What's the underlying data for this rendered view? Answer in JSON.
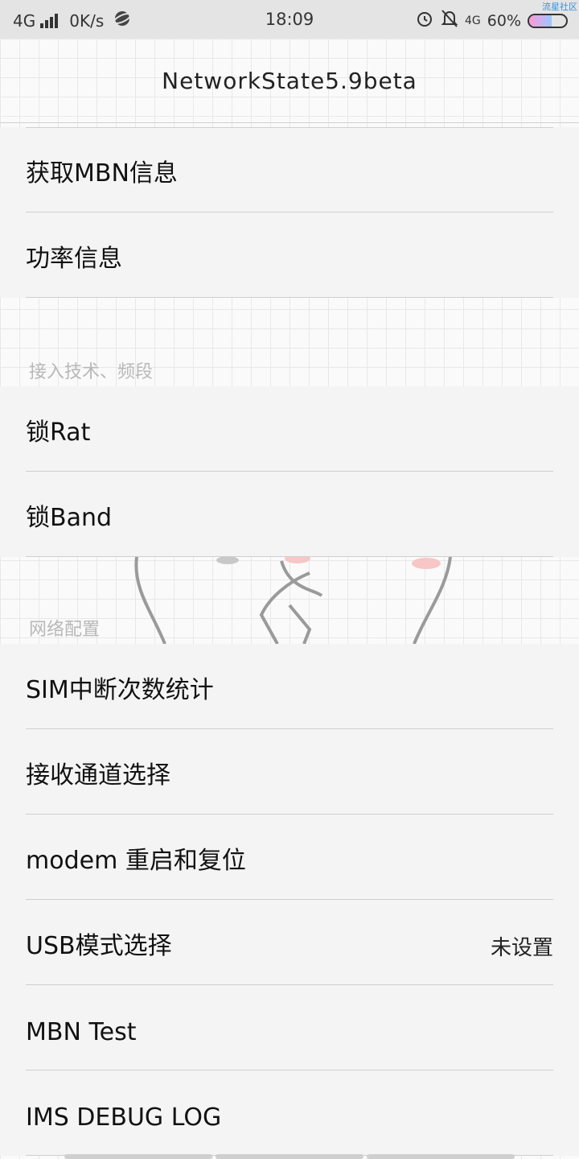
{
  "status_bar": {
    "network": "4G",
    "speed": "0K/s",
    "time": "18:09",
    "network_right": "4G",
    "battery_percent": "60%",
    "battery_level": 0.6,
    "corner_label": "流星社区",
    "icons": [
      "signal-icon",
      "planet-icon",
      "alarm-icon",
      "bell-off-icon",
      "battery-icon"
    ]
  },
  "title": "NetworkState5.9beta",
  "sections": {
    "info": [
      {
        "label": "获取MBN信息"
      },
      {
        "label": "功率信息"
      }
    ],
    "access_header": "接入技术、频段",
    "access": [
      {
        "label": "锁Rat"
      },
      {
        "label": "锁Band"
      }
    ],
    "network_header": "网络配置",
    "network": [
      {
        "label": "SIM中断次数统计"
      },
      {
        "label": "接收通道选择"
      },
      {
        "label": "modem 重启和复位"
      },
      {
        "label": "USB模式选择",
        "value": "未设置"
      },
      {
        "label": "MBN Test"
      },
      {
        "label": "IMS DEBUG LOG"
      }
    ]
  },
  "colors": {
    "status_bg": "#e4e4e4",
    "row_bg": "#f4f4f4",
    "divider": "#cfcfcf",
    "category_text": "#b8b8b8",
    "accent_link": "#3a8fd9"
  }
}
